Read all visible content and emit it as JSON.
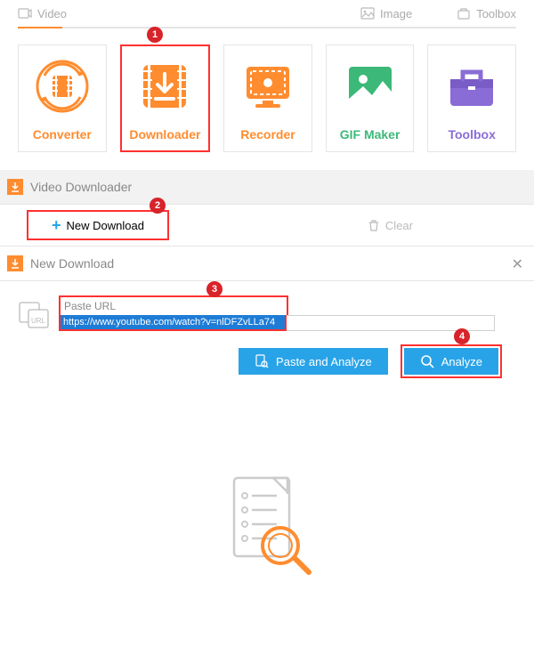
{
  "top_tabs": {
    "video": "Video",
    "image": "Image",
    "toolbox": "Toolbox"
  },
  "tools": {
    "converter": "Converter",
    "downloader": "Downloader",
    "recorder": "Recorder",
    "gifmaker": "GIF Maker",
    "toolbox": "Toolbox"
  },
  "section1": {
    "title": "Video Downloader"
  },
  "toolbar": {
    "new_download": "New Download",
    "clear": "Clear"
  },
  "section2": {
    "title": "New Download"
  },
  "url_input": {
    "hint": "Paste URL",
    "value": "https://www.youtube.com/watch?v=nlDFZvLLa74"
  },
  "buttons": {
    "paste_analyze": "Paste and Analyze",
    "analyze": "Analyze"
  },
  "callouts": {
    "c1": "1",
    "c2": "2",
    "c3": "3",
    "c4": "4"
  }
}
